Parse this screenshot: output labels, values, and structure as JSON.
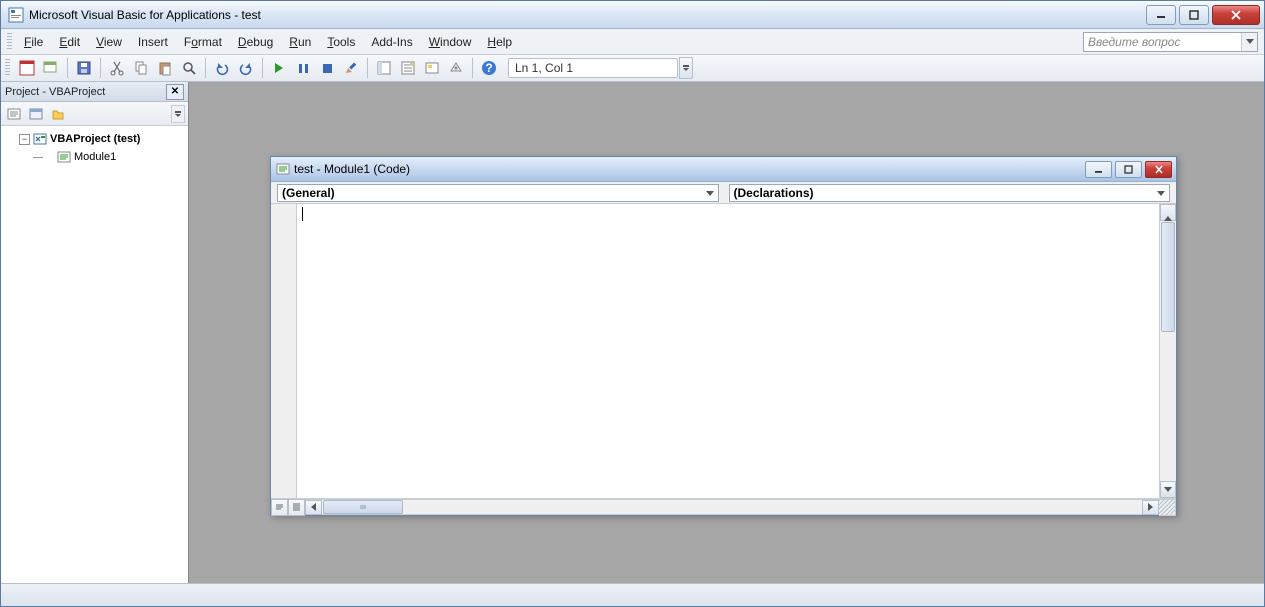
{
  "titlebar": {
    "title": "Microsoft Visual Basic for Applications - test"
  },
  "menus": {
    "file": "File",
    "edit": "Edit",
    "view": "View",
    "insert": "Insert",
    "format": "Format",
    "debug": "Debug",
    "run": "Run",
    "tools": "Tools",
    "addins": "Add-Ins",
    "window": "Window",
    "help": "Help"
  },
  "ask_box": {
    "placeholder": "Введите вопрос"
  },
  "toolbar": {
    "cursor_pos": "Ln 1, Col 1"
  },
  "project_pane": {
    "title": "Project - VBAProject",
    "root": "VBAProject (test)",
    "module": "Module1"
  },
  "code_window": {
    "title": "test - Module1 (Code)",
    "object_dd": "(General)",
    "proc_dd": "(Declarations)",
    "content": ""
  }
}
